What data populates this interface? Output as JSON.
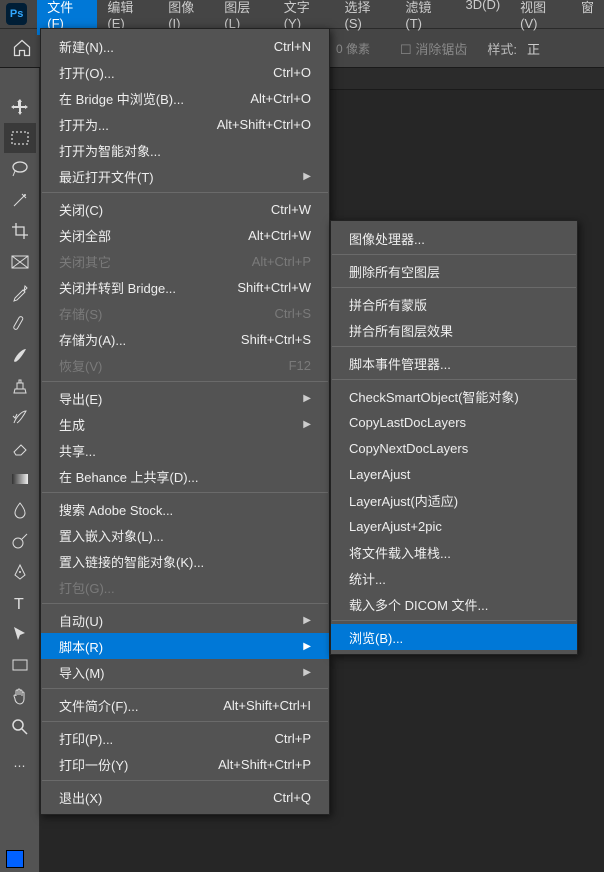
{
  "app": {
    "icon_text": "Ps"
  },
  "menubar": {
    "items": [
      {
        "label": "文件(F)",
        "active": true
      },
      {
        "label": "编辑(E)"
      },
      {
        "label": "图像(I)"
      },
      {
        "label": "图层(L)"
      },
      {
        "label": "文字(Y)"
      },
      {
        "label": "选择(S)"
      },
      {
        "label": "滤镜(T)"
      },
      {
        "label": "3D(D)"
      },
      {
        "label": "视图(V)"
      },
      {
        "label": "窗"
      }
    ]
  },
  "optionbar": {
    "pixels_value": "0",
    "pixels_unit": "像素",
    "antialias_label": "消除锯齿",
    "style_label": "样式:",
    "style_value": "正"
  },
  "file_menu": [
    {
      "label": "新建(N)...",
      "shortcut": "Ctrl+N"
    },
    {
      "label": "打开(O)...",
      "shortcut": "Ctrl+O"
    },
    {
      "label": "在 Bridge 中浏览(B)...",
      "shortcut": "Alt+Ctrl+O"
    },
    {
      "label": "打开为...",
      "shortcut": "Alt+Shift+Ctrl+O"
    },
    {
      "label": "打开为智能对象..."
    },
    {
      "label": "最近打开文件(T)",
      "submenu": true
    },
    {
      "sep": true
    },
    {
      "label": "关闭(C)",
      "shortcut": "Ctrl+W"
    },
    {
      "label": "关闭全部",
      "shortcut": "Alt+Ctrl+W"
    },
    {
      "label": "关闭其它",
      "shortcut": "Alt+Ctrl+P",
      "disabled": true
    },
    {
      "label": "关闭并转到 Bridge...",
      "shortcut": "Shift+Ctrl+W"
    },
    {
      "label": "存储(S)",
      "shortcut": "Ctrl+S",
      "disabled": true
    },
    {
      "label": "存储为(A)...",
      "shortcut": "Shift+Ctrl+S"
    },
    {
      "label": "恢复(V)",
      "shortcut": "F12",
      "disabled": true
    },
    {
      "sep": true
    },
    {
      "label": "导出(E)",
      "submenu": true
    },
    {
      "label": "生成",
      "submenu": true
    },
    {
      "label": "共享..."
    },
    {
      "label": "在 Behance 上共享(D)..."
    },
    {
      "sep": true
    },
    {
      "label": "搜索 Adobe Stock..."
    },
    {
      "label": "置入嵌入对象(L)..."
    },
    {
      "label": "置入链接的智能对象(K)..."
    },
    {
      "label": "打包(G)...",
      "disabled": true
    },
    {
      "sep": true
    },
    {
      "label": "自动(U)",
      "submenu": true
    },
    {
      "label": "脚本(R)",
      "submenu": true,
      "highlighted": true
    },
    {
      "label": "导入(M)",
      "submenu": true
    },
    {
      "sep": true
    },
    {
      "label": "文件简介(F)...",
      "shortcut": "Alt+Shift+Ctrl+I"
    },
    {
      "sep": true
    },
    {
      "label": "打印(P)...",
      "shortcut": "Ctrl+P"
    },
    {
      "label": "打印一份(Y)",
      "shortcut": "Alt+Shift+Ctrl+P"
    },
    {
      "sep": true
    },
    {
      "label": "退出(X)",
      "shortcut": "Ctrl+Q"
    }
  ],
  "script_submenu": [
    {
      "label": "图像处理器..."
    },
    {
      "sep": true
    },
    {
      "label": "删除所有空图层"
    },
    {
      "sep": true
    },
    {
      "label": "拼合所有蒙版"
    },
    {
      "label": "拼合所有图层效果"
    },
    {
      "sep": true
    },
    {
      "label": "脚本事件管理器..."
    },
    {
      "sep": true
    },
    {
      "label": "CheckSmartObject(智能对象)"
    },
    {
      "label": "CopyLastDocLayers"
    },
    {
      "label": "CopyNextDocLayers"
    },
    {
      "label": "LayerAjust"
    },
    {
      "label": "LayerAjust(内适应)"
    },
    {
      "label": "LayerAjust+2pic"
    },
    {
      "label": "将文件载入堆栈..."
    },
    {
      "label": "统计..."
    },
    {
      "label": "载入多个 DICOM 文件..."
    },
    {
      "sep": true
    },
    {
      "label": "浏览(B)...",
      "highlighted": true
    }
  ],
  "swatches": {
    "fg": "#0061ff",
    "bg": "#ffffff"
  }
}
